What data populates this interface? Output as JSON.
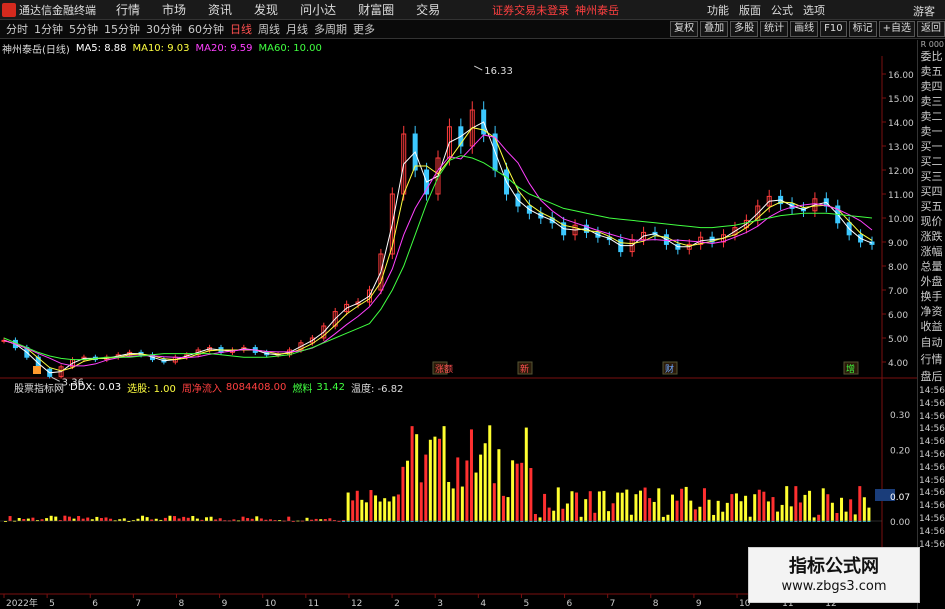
{
  "title_bar": {
    "app_title": "通达信金融终端",
    "menu": [
      "行情",
      "市场",
      "资讯",
      "发现",
      "问小达",
      "财富圈",
      "交易"
    ],
    "notice": "证券交易未登录",
    "stock_link": "神州泰岳",
    "right_menu": [
      "功能",
      "版面",
      "公式",
      "选项"
    ],
    "guest": "游客"
  },
  "period_bar": {
    "periods": [
      "分时",
      "1分钟",
      "5分钟",
      "15分钟",
      "30分钟",
      "60分钟",
      "日线",
      "周线",
      "月线",
      "多周期",
      "更多"
    ],
    "active": "日线",
    "tools": [
      "复权",
      "叠加",
      "多股",
      "统计",
      "画线",
      "F10",
      "标记",
      "+自选",
      "返回"
    ]
  },
  "main_chart": {
    "stock": "神州泰岳(日线)",
    "ma": [
      {
        "label": "MA5: 8.88",
        "color": "#ffffff"
      },
      {
        "label": "MA10: 9.03",
        "color": "#ffff40"
      },
      {
        "label": "MA20: 9.59",
        "color": "#ff40ff"
      },
      {
        "label": "MA60: 10.00",
        "color": "#40ff40"
      }
    ],
    "high_label": "16.33",
    "low_label": "3.36",
    "y_ticks": [
      "16.00",
      "15.00",
      "14.00",
      "13.00",
      "12.00",
      "11.00",
      "10.00",
      "9.00",
      "8.00",
      "7.00",
      "6.00",
      "5.00",
      "4.00"
    ],
    "event_markers": [
      "涨额",
      "新",
      "财",
      "增"
    ]
  },
  "indicator": {
    "name": "股票指标网",
    "ddx": "DDX: 0.03",
    "xuangu": "选股: 1.00",
    "inflow": "周净流入",
    "inflow_value": "8084408.00",
    "fuel": "燃料",
    "fuel_value": "31.42",
    "temp": "温度: -6.82",
    "y_ticks": [
      "0.30",
      "0.20",
      "0.07",
      "0.00"
    ]
  },
  "x_axis": [
    "2022年",
    "5",
    "6",
    "7",
    "8",
    "9",
    "10",
    "11",
    "12",
    "2",
    "3",
    "4",
    "5",
    "6",
    "7",
    "8",
    "9",
    "10",
    "11",
    "12"
  ],
  "right_panel": {
    "top": "R 000",
    "items": [
      "委比",
      "卖五",
      "卖四",
      "卖三",
      "卖二",
      "卖一",
      "买一",
      "买二",
      "买三",
      "买四",
      "买五",
      "现价",
      "涨跌",
      "涨幅",
      "总量",
      "外盘",
      "换手",
      "净资",
      "收益"
    ],
    "commands": [
      "自动",
      "行情",
      "盘后"
    ],
    "times": [
      "14:56",
      "14:56",
      "14:56",
      "14:56",
      "14:56",
      "14:56",
      "14:56",
      "14:56",
      "14:56",
      "14:56",
      "14:56",
      "14:56",
      "14:56"
    ]
  },
  "watermark": {
    "title": "指标公式网",
    "url": "www.zbgs3.com"
  },
  "chart_data": {
    "type": "line",
    "price_series": {
      "name": "神州泰岳(日线)",
      "x": [
        0,
        5,
        10,
        15,
        20,
        25,
        30,
        35,
        40,
        45,
        50,
        55,
        60,
        65,
        70,
        75,
        80,
        85,
        90,
        95,
        100,
        105,
        110,
        115,
        120,
        125,
        130,
        135,
        140,
        145,
        150,
        155,
        160,
        165,
        170,
        175,
        180,
        185,
        190,
        195,
        200,
        205,
        210,
        215,
        220,
        225,
        230,
        235,
        240,
        245,
        250,
        255,
        260,
        265,
        270,
        275,
        280,
        285,
        290,
        295,
        300,
        305,
        310,
        315,
        320,
        325,
        330,
        335,
        340,
        345,
        350,
        355,
        360,
        365,
        370,
        375,
        380
      ],
      "values": [
        4.9,
        4.6,
        4.2,
        3.7,
        3.4,
        3.8,
        4.1,
        4.2,
        4.1,
        4.2,
        4.3,
        4.4,
        4.3,
        4.1,
        4.0,
        4.2,
        4.3,
        4.5,
        4.6,
        4.4,
        4.5,
        4.6,
        4.4,
        4.3,
        4.3,
        4.5,
        4.8,
        5.0,
        5.5,
        6.1,
        6.4,
        6.5,
        7.0,
        8.5,
        11.0,
        13.5,
        12.0,
        11.0,
        12.5,
        13.8,
        13.0,
        14.5,
        13.5,
        12.0,
        11.0,
        10.5,
        10.2,
        10.0,
        9.8,
        9.3,
        9.7,
        9.4,
        9.2,
        9.1,
        8.6,
        9.1,
        9.4,
        9.3,
        8.9,
        8.7,
        8.9,
        9.2,
        9.0,
        9.3,
        9.6,
        9.9,
        10.5,
        10.9,
        10.6,
        10.4,
        10.3,
        10.8,
        10.5,
        9.8,
        9.3,
        9.0,
        8.9
      ]
    },
    "ma60": [
      5.0,
      4.8,
      4.6,
      4.4,
      4.25,
      4.15,
      4.1,
      4.1,
      4.15,
      4.2,
      4.2,
      4.2,
      4.25,
      4.3,
      4.35,
      4.35,
      4.35,
      4.35,
      4.35,
      4.3,
      4.25,
      4.2,
      4.2,
      4.2,
      4.25,
      4.3,
      4.45,
      4.6,
      4.8,
      5.0,
      5.2,
      5.4,
      5.6,
      6.2,
      7.0,
      8.0,
      9.3,
      10.6,
      11.7,
      12.4,
      12.6,
      12.5,
      12.3,
      12.0,
      11.7,
      11.3,
      11.0,
      10.8,
      10.6,
      10.4,
      10.3,
      10.2,
      10.1,
      10.0,
      9.95,
      9.9,
      9.85,
      9.8,
      9.75,
      9.7,
      9.65,
      9.6,
      9.6,
      9.65,
      9.7,
      9.8,
      9.9,
      10.0,
      10.1,
      10.15,
      10.2,
      10.2,
      10.2,
      10.15,
      10.1,
      10.05,
      10.0
    ],
    "ylim": [
      3.5,
      16.5
    ],
    "high": 16.33,
    "low": 3.36
  }
}
